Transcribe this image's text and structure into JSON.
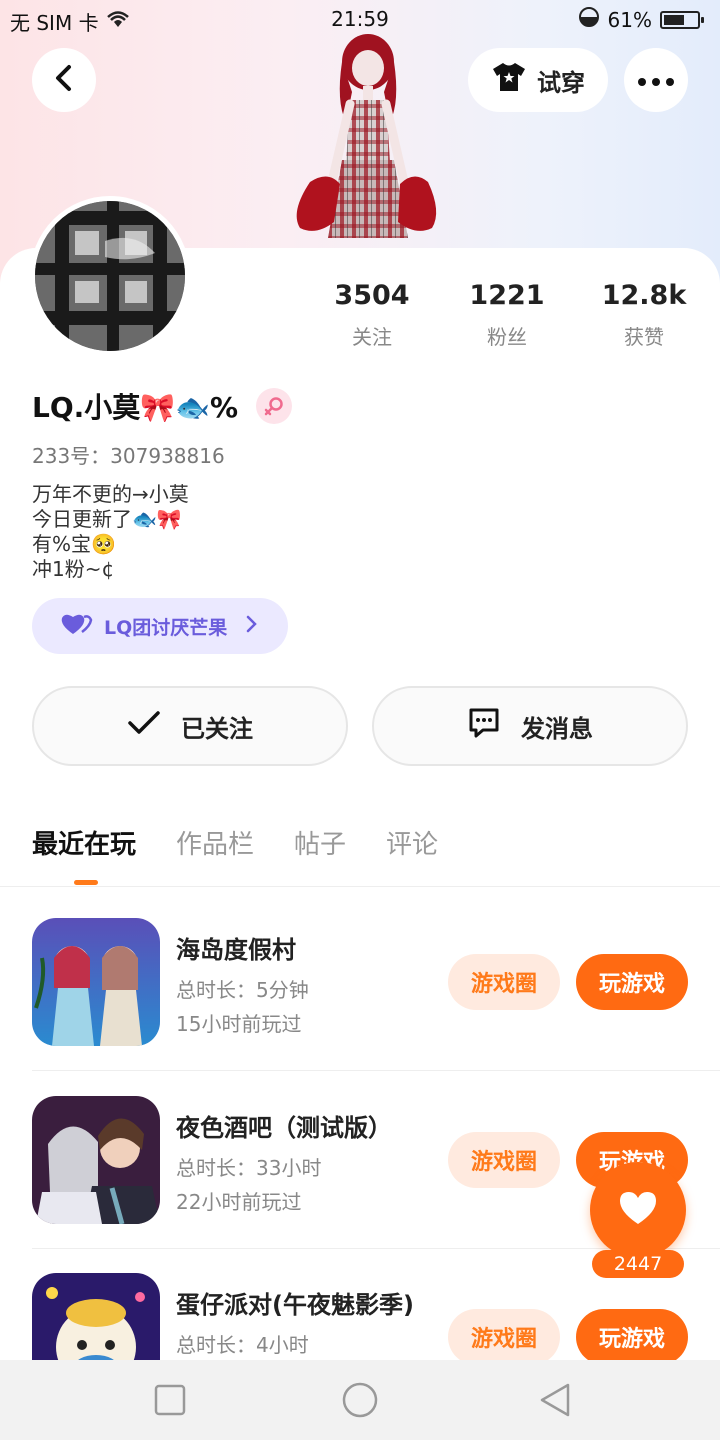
{
  "status_bar": {
    "carrier": "无 SIM 卡",
    "time": "21:59",
    "battery": "61%",
    "battery_level": 0.61
  },
  "header": {
    "try_on_label": "试穿"
  },
  "profile": {
    "stats": [
      {
        "value": "3504",
        "label": "关注"
      },
      {
        "value": "1221",
        "label": "粉丝"
      },
      {
        "value": "12.8k",
        "label": "获赞"
      }
    ],
    "username": "LQ.小莫🎀🐟%",
    "uid": "233号：307938816",
    "bio": [
      "万年不更的→小莫",
      "今日更新了🐟🎀",
      "有%宝🥺",
      "冲1粉~¢"
    ],
    "group_label": "LQ团讨厌芒果"
  },
  "actions": {
    "follow_label": "已关注",
    "message_label": "发消息"
  },
  "tabs": [
    {
      "label": "最近在玩",
      "active": true
    },
    {
      "label": "作品栏",
      "active": false
    },
    {
      "label": "帖子",
      "active": false
    },
    {
      "label": "评论",
      "active": false
    }
  ],
  "games": [
    {
      "name": "海岛度假村",
      "duration": "总时长：5分钟",
      "last_played": "15小时前玩过",
      "circle_label": "游戏圈",
      "play_label": "玩游戏"
    },
    {
      "name": "夜色酒吧（测试版）",
      "duration": "总时长：33小时",
      "last_played": "22小时前玩过",
      "circle_label": "游戏圈",
      "play_label": "玩游戏"
    },
    {
      "name": "蛋仔派对(午夜魅影季)",
      "duration": "总时长：4小时",
      "last_played": "",
      "circle_label": "游戏圈",
      "play_label": "玩游戏"
    }
  ],
  "like_fab": {
    "count": "2447"
  },
  "colors": {
    "accent": "#ff6a12",
    "accent_light": "#ffeadf",
    "group_chip_bg": "#ebe9ff",
    "group_chip_text": "#6a5cdc"
  }
}
